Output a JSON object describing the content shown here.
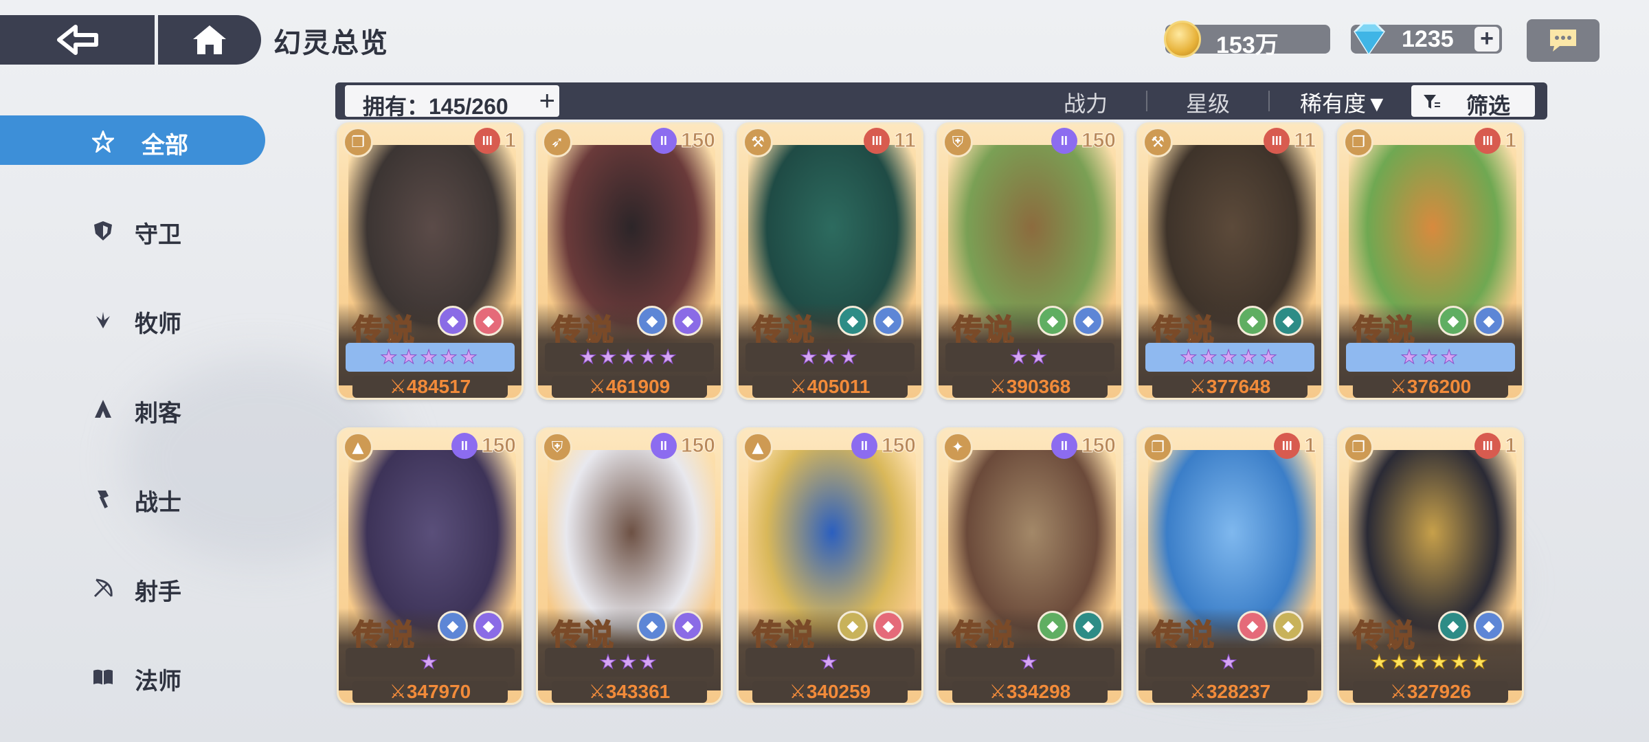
{
  "header": {
    "title": "幻灵总览"
  },
  "resources": {
    "gold": "153万",
    "gems": "1235"
  },
  "sidebar": {
    "items": [
      {
        "label": "全部",
        "icon": "all-icon",
        "active": true
      },
      {
        "label": "守卫",
        "icon": "shield-icon",
        "active": false
      },
      {
        "label": "牧师",
        "icon": "priest-wing-icon",
        "active": false
      },
      {
        "label": "刺客",
        "icon": "assassin-hood-icon",
        "active": false
      },
      {
        "label": "战士",
        "icon": "warrior-axe-icon",
        "active": false
      },
      {
        "label": "射手",
        "icon": "bow-icon",
        "active": false
      },
      {
        "label": "法师",
        "icon": "book-icon",
        "active": false
      }
    ]
  },
  "filterbar": {
    "owned": "拥有：145/260",
    "sort_power": "战力",
    "sort_star": "星级",
    "sort_rarity": "稀有度▼",
    "filter": "筛选"
  },
  "cards": [
    {
      "class": "book",
      "tier_color": "red",
      "tier": "1",
      "rarity": "传说",
      "elements": [
        "#8a6be6",
        "#e56a79"
      ],
      "stars": "★★★★★",
      "star_style": "blue",
      "power": "484517",
      "art": [
        "#3c3533",
        "#5b4b48"
      ]
    },
    {
      "class": "bow",
      "tier_color": "purple",
      "tier": "150",
      "rarity": "传说",
      "elements": [
        "#5d86d6",
        "#8a6be6"
      ],
      "stars": "★★★★★",
      "star_style": "dark",
      "power": "461909",
      "art": [
        "#6a3a3a",
        "#2c2528"
      ]
    },
    {
      "class": "axe",
      "tier_color": "red",
      "tier": "11",
      "rarity": "传说",
      "elements": [
        "#2d8c86",
        "#5d86d6"
      ],
      "stars": "★★★",
      "star_style": "dark",
      "power": "405011",
      "art": [
        "#1f4b45",
        "#2d6b5f"
      ]
    },
    {
      "class": "shield",
      "tier_color": "purple",
      "tier": "150",
      "rarity": "传说",
      "elements": [
        "#5fae62",
        "#5d86d6"
      ],
      "stars": "★★",
      "star_style": "dark",
      "power": "390368",
      "art": [
        "#7aa055",
        "#8c6b3e"
      ]
    },
    {
      "class": "axe",
      "tier_color": "red",
      "tier": "11",
      "rarity": "传说",
      "elements": [
        "#5fae62",
        "#2d8c86"
      ],
      "stars": "★★★★★",
      "star_style": "blue",
      "power": "377648",
      "art": [
        "#3e332a",
        "#5c4a3a"
      ]
    },
    {
      "class": "book",
      "tier_color": "red",
      "tier": "1",
      "rarity": "传说",
      "elements": [
        "#5fae62",
        "#5d86d6"
      ],
      "stars": "★★★",
      "star_style": "blue",
      "power": "376200",
      "art": [
        "#6fa852",
        "#d88a3e"
      ]
    },
    {
      "class": "hood",
      "tier_color": "purple",
      "tier": "150",
      "rarity": "传说",
      "elements": [
        "#5d86d6",
        "#8a6be6"
      ],
      "stars": "★",
      "star_style": "dark",
      "power": "347970",
      "art": [
        "#3d3358",
        "#5a4f7a"
      ]
    },
    {
      "class": "shield",
      "tier_color": "purple",
      "tier": "150",
      "rarity": "传说",
      "elements": [
        "#5d86d6",
        "#8a6be6"
      ],
      "stars": "★★★",
      "star_style": "dark",
      "power": "343361",
      "art": [
        "#e8e8ee",
        "#6d5144"
      ]
    },
    {
      "class": "hood",
      "tier_color": "purple",
      "tier": "150",
      "rarity": "传说",
      "elements": [
        "#c8b25a",
        "#e56a79"
      ],
      "stars": "★",
      "star_style": "dark",
      "power": "340259",
      "art": [
        "#d9b85a",
        "#2b5fbf"
      ]
    },
    {
      "class": "priest",
      "tier_color": "purple",
      "tier": "150",
      "rarity": "传说",
      "elements": [
        "#5fae62",
        "#2d8c86"
      ],
      "stars": "★",
      "star_style": "dark",
      "power": "334298",
      "art": [
        "#6b4a3a",
        "#a38868"
      ]
    },
    {
      "class": "book",
      "tier_color": "red",
      "tier": "1",
      "rarity": "传说",
      "elements": [
        "#e56a79",
        "#c8b25a"
      ],
      "stars": "★",
      "star_style": "dark",
      "power": "328237",
      "art": [
        "#3b7ec8",
        "#7fb8ee"
      ]
    },
    {
      "class": "book",
      "tier_color": "red",
      "tier": "1",
      "rarity": "传说",
      "elements": [
        "#2d8c86",
        "#5d86d6"
      ],
      "stars": "★★★★★★",
      "star_style": "gold",
      "power": "327926",
      "art": [
        "#2a2a35",
        "#c7a04a"
      ]
    }
  ]
}
